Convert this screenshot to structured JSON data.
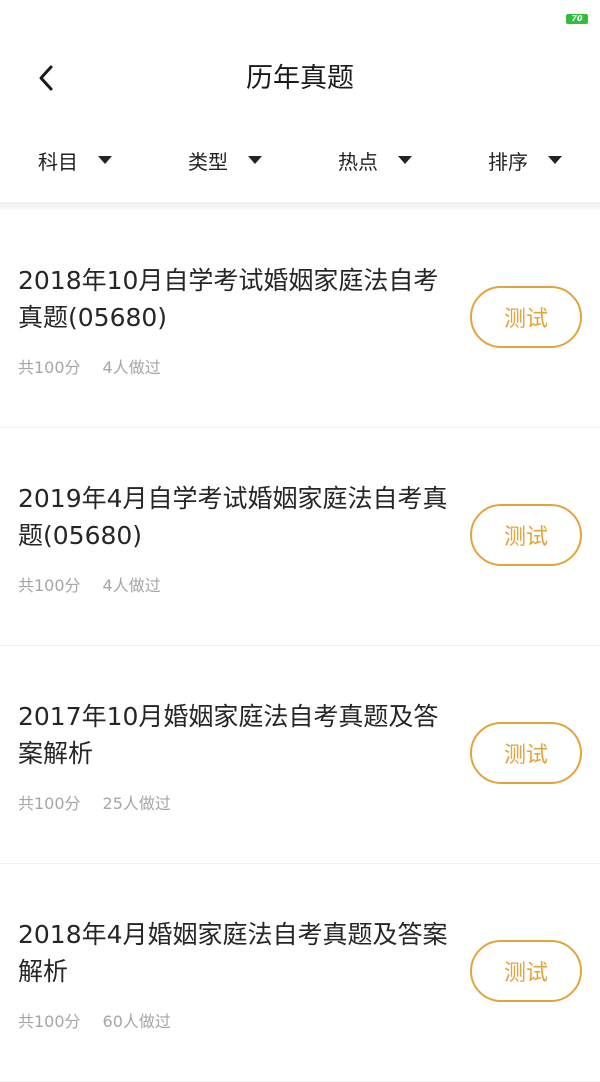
{
  "status_bar": {
    "battery_label": "70",
    "battery_color": "#2fbf3a"
  },
  "header": {
    "back_icon": "chevron-left-icon",
    "title": "历年真题"
  },
  "filters": [
    {
      "label": "科目",
      "icon": "caret-down-icon"
    },
    {
      "label": "类型",
      "icon": "caret-down-icon"
    },
    {
      "label": "热点",
      "icon": "caret-down-icon"
    },
    {
      "label": "排序",
      "icon": "caret-down-icon"
    }
  ],
  "accent_color": "#e3a43a",
  "items": [
    {
      "title": "2018年10月自学考试婚姻家庭法自考真题(05680)",
      "score": "共100分",
      "taken": "4人做过",
      "button": "测试"
    },
    {
      "title": "2019年4月自学考试婚姻家庭法自考真题(05680)",
      "score": "共100分",
      "taken": "4人做过",
      "button": "测试"
    },
    {
      "title": "2017年10月婚姻家庭法自考真题及答案解析",
      "score": "共100分",
      "taken": "25人做过",
      "button": "测试"
    },
    {
      "title": "2018年4月婚姻家庭法自考真题及答案解析",
      "score": "共100分",
      "taken": "60人做过",
      "button": "测试"
    }
  ]
}
